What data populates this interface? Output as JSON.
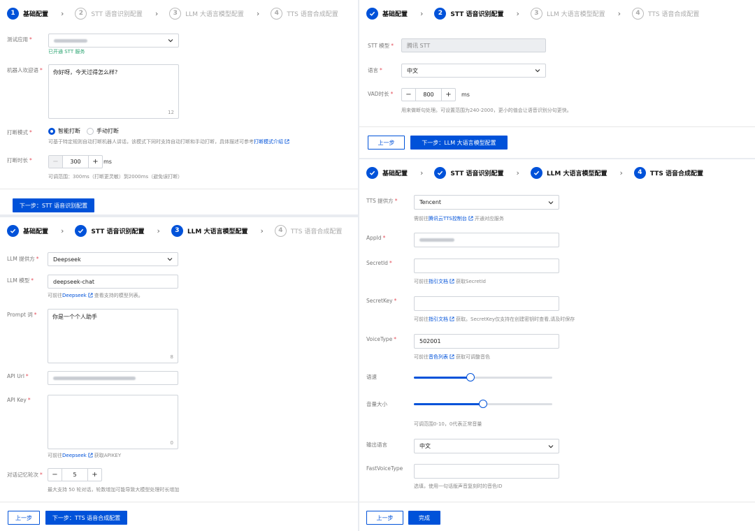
{
  "step_labels": [
    "基础配置",
    "STT 语音识别配置",
    "LLM 大语言模型配置",
    "TTS 语音合成配置"
  ],
  "step_numbers": [
    "1",
    "2",
    "3",
    "4"
  ],
  "colors": {
    "primary": "#0052d9",
    "success": "#2ba471",
    "required": "#e34d59"
  },
  "icons": {
    "done": "check-icon",
    "chevron": "chevron-right-icon",
    "dropdown": "chevron-down-icon",
    "external": "external-link-icon"
  },
  "basic": {
    "app_label": "测试应用",
    "app_value_hidden": "",
    "app_status": "已开通 STT 服务",
    "welcome_label": "机器人欢迎语",
    "welcome_value": "你好呀，今天过得怎么样?",
    "welcome_count": "12",
    "interrupt_label": "打断模式",
    "interrupt_options": [
      "智能打断",
      "手动打断"
    ],
    "interrupt_help": "可基于特定规则自动打断机器人讲话，该模式下同时支持自动打断和手动打断，具体描述可参考",
    "interrupt_help_link": "打断模式介绍",
    "duration_label": "打断时长",
    "duration_value": "300",
    "duration_unit": "ms",
    "duration_help": "可调范围：300ms（打断更灵敏）到2000ms（避免误打断）",
    "next_button": "下一步：STT 语音识别配置"
  },
  "llm": {
    "provider_label": "LLM 提供方",
    "provider_value": "Deepseek",
    "model_label": "LLM 模型",
    "model_value": "deepseek-chat",
    "model_help_pre": "可前往",
    "model_help_link": "Deepseek",
    "model_help_post": "查看支持的模型列表。",
    "prompt_label": "Prompt 词",
    "prompt_value": "你是一个个人助手",
    "prompt_count": "8",
    "url_label": "API Url",
    "key_label": "API Key",
    "key_count": "0",
    "key_help_pre": "可前往",
    "key_help_link": "Deepseek",
    "key_help_post": "获取APIKEY",
    "rounds_label": "对话记忆轮次",
    "rounds_value": "5",
    "rounds_help": "最大支持 50 轮对话，轮数增加可能导致大模型处理时长增加",
    "prev_button": "上一步",
    "next_button": "下一步：TTS 语音合成配置"
  },
  "stt": {
    "model_label": "STT 模型",
    "model_value": "腾讯 STT",
    "lang_label": "语言",
    "lang_value": "中文",
    "vad_label": "VAD时长",
    "vad_value": "800",
    "vad_unit": "ms",
    "vad_help": "用来做断句处理。可设置范围为240-2000，更小的值会让语音识别分句更快。",
    "prev_button": "上一步",
    "next_button": "下一步：LLM 大语言模型配置"
  },
  "tts": {
    "provider_label": "TTS 提供方",
    "provider_value": "Tencent",
    "provider_help_pre": "需前往",
    "provider_help_link": "腾讯云TTS控制台",
    "provider_help_post": "开通对应服务",
    "appid_label": "AppId",
    "secretid_label": "SecretId",
    "secretid_help_pre": "可前往",
    "secretid_help_link": "指引文档",
    "secretid_help_post": "获取SecretId",
    "secretkey_label": "SecretKey",
    "secretkey_help_pre": "可前往",
    "secretkey_help_link": "指引文档",
    "secretkey_help_post": "获取。SecretKey仅支持在创建密钥时查看,请及时保存",
    "voicetype_label": "VoiceType",
    "voicetype_value": "502001",
    "voicetype_help_pre": "可前往",
    "voicetype_help_link": "音色列表",
    "voicetype_help_post": "获取可调整音色",
    "speed_label": "语速",
    "speed_level": 0.41,
    "volume_label": "音量大小",
    "volume_level": 0.5,
    "volume_help": "可调范围0-10，0代表正常音量",
    "lang_label": "输出语言",
    "lang_value": "中文",
    "fast_label": "FastVoiceType",
    "fast_help": "选填，使用一句话版声音复刻时的音色ID",
    "prev_button": "上一步",
    "finish_button": "完成"
  }
}
